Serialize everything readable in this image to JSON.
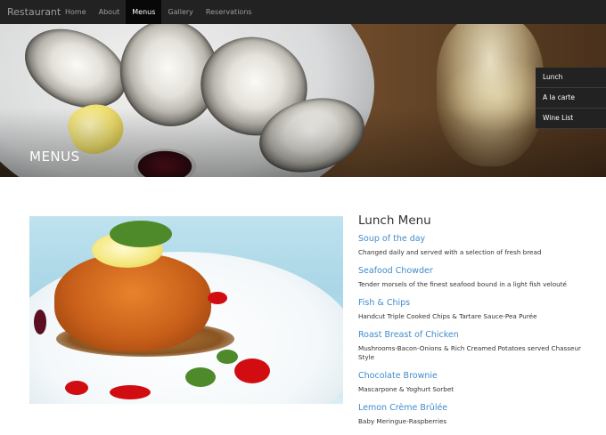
{
  "navbar": {
    "brand": "Restaurant",
    "links": [
      "Home",
      "About",
      "Menus",
      "Gallery",
      "Reservations"
    ],
    "active": "Menus"
  },
  "hero": {
    "title": "MENUS",
    "submenu": [
      "Lunch",
      "A la carte",
      "Wine List"
    ]
  },
  "menu": {
    "heading": "Lunch Menu",
    "items": [
      {
        "name": "Soup of the day",
        "desc": "Changed daily and served with a selection of fresh bread"
      },
      {
        "name": "Seafood Chowder",
        "desc": "Tender morsels of the finest seafood bound in a light fish velouté"
      },
      {
        "name": "Fish & Chips",
        "desc": "Handcut Triple Cooked Chips & Tartare Sauce-Pea Purée"
      },
      {
        "name": "Roast Breast of Chicken",
        "desc": "Mushrooms-Bacon-Onions & Rich Creamed Potatoes served Chasseur Style"
      },
      {
        "name": "Chocolate Brownie",
        "desc": "Mascarpone & Yoghurt Sorbet"
      },
      {
        "name": "Lemon Crème Brûlée",
        "desc": "Baby Meringue-Raspberries"
      }
    ]
  },
  "colors": {
    "accent": "#428bca",
    "navbar": "#222222"
  }
}
